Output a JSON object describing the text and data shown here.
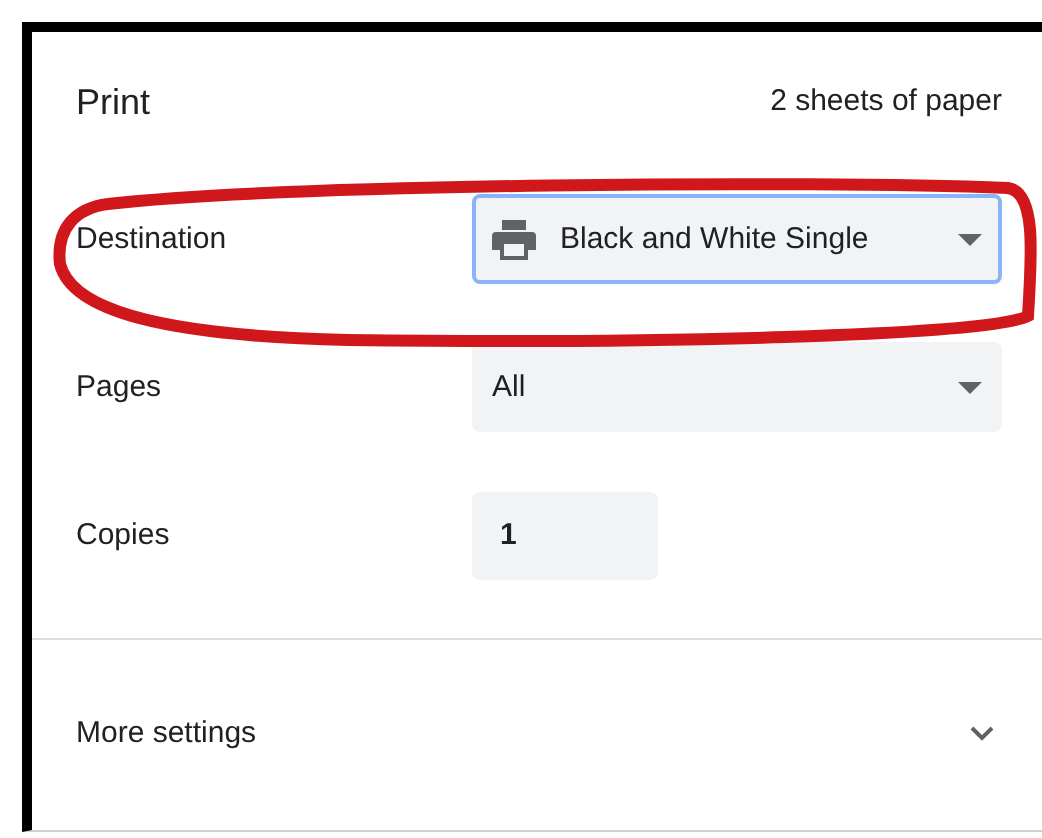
{
  "header": {
    "title": "Print",
    "summary": "2 sheets of paper"
  },
  "settings": [
    {
      "kind": "destination",
      "label": "Destination",
      "value": "Black and White Single",
      "focused": true
    },
    {
      "kind": "select",
      "label": "Pages",
      "value": "All",
      "focused": false
    },
    {
      "kind": "number",
      "label": "Copies",
      "value": "1",
      "focused": false
    }
  ],
  "more_settings": {
    "label": "More settings",
    "expanded": false
  }
}
